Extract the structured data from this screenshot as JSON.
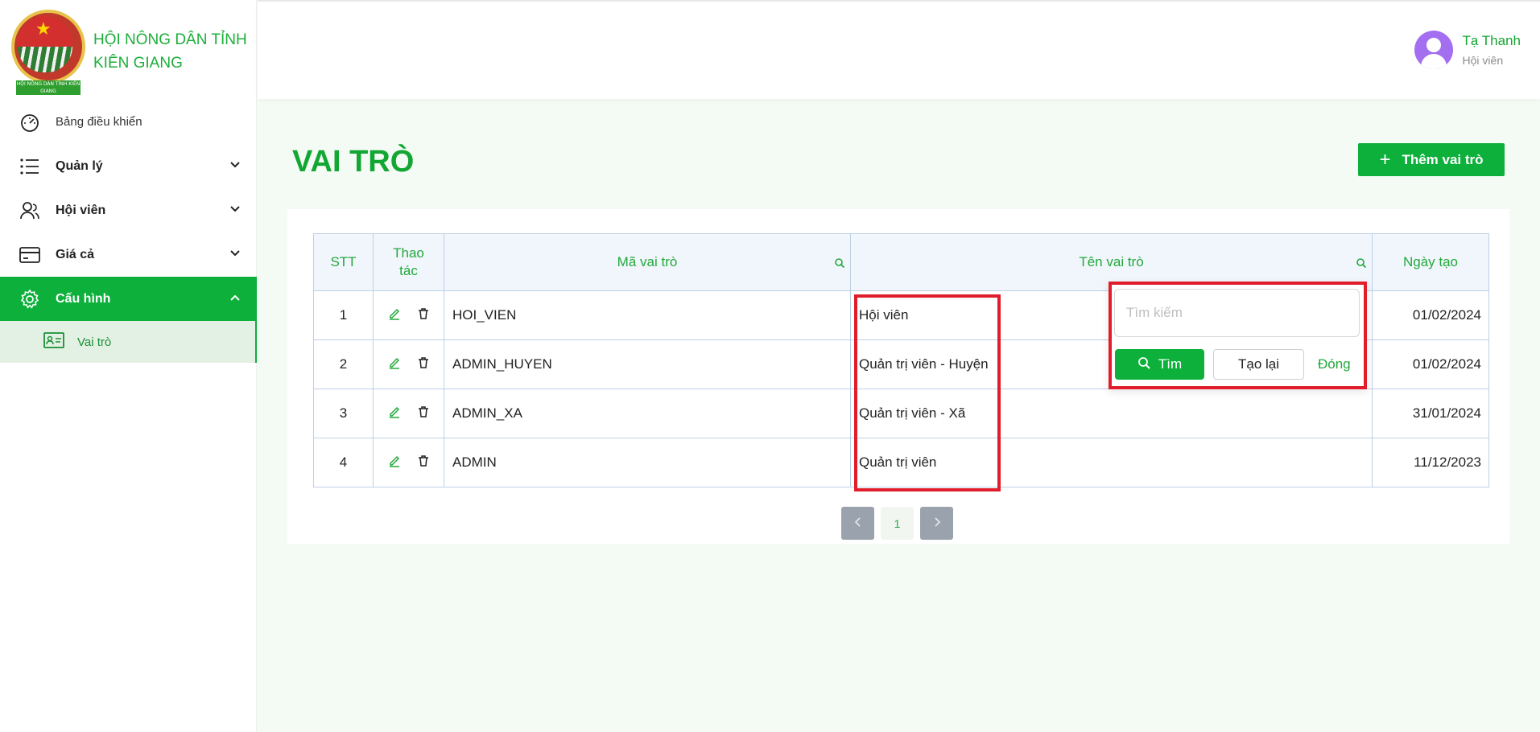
{
  "brand": {
    "name": "HỘI NÔNG DÂN TỈNH KIÊN GIANG",
    "logo_ribbon": "HỘI NÔNG DÂN TỈNH KIÊN GIANG"
  },
  "sidebar": {
    "items": [
      {
        "label": "Bảng điều khiển",
        "icon": "dashboard-gauge-icon"
      },
      {
        "label": "Quản lý",
        "icon": "list-icon",
        "chevron": "down"
      },
      {
        "label": "Hội viên",
        "icon": "users-icon",
        "chevron": "down"
      },
      {
        "label": "Giá cả",
        "icon": "credit-card-icon",
        "chevron": "down"
      },
      {
        "label": "Cấu hình",
        "icon": "gear-icon",
        "chevron": "up",
        "active": true
      }
    ],
    "sub_items": [
      {
        "label": "Vai trò",
        "icon": "id-card-icon",
        "active": true
      }
    ]
  },
  "header": {
    "user_name": "Tạ Thanh",
    "user_role": "Hội viên"
  },
  "page": {
    "title": "VAI TRÒ",
    "add_button": "Thêm vai trò"
  },
  "table": {
    "columns": [
      "STT",
      "Thao tác",
      "Mã vai trò",
      "Tên vai trò",
      "Ngày tạo"
    ],
    "rows": [
      {
        "stt": "1",
        "code": "HOI_VIEN",
        "name": "Hội viên",
        "date": "01/02/2024"
      },
      {
        "stt": "2",
        "code": "ADMIN_HUYEN",
        "name": "Quản trị viên - Huyện",
        "date": "01/02/2024"
      },
      {
        "stt": "3",
        "code": "ADMIN_XA",
        "name": "Quản trị viên - Xã",
        "date": "31/01/2024"
      },
      {
        "stt": "4",
        "code": "ADMIN",
        "name": "Quản trị viên",
        "date": "11/12/2023"
      }
    ]
  },
  "pagination": {
    "current_page": "1"
  },
  "search_popup": {
    "placeholder": "Tìm kiếm",
    "find_label": "Tìm",
    "reset_label": "Tạo lại",
    "close_label": "Đóng"
  },
  "colors": {
    "primary": "#0cb03b",
    "highlight": "#e01e2b",
    "avatar": "#a46ef0"
  }
}
